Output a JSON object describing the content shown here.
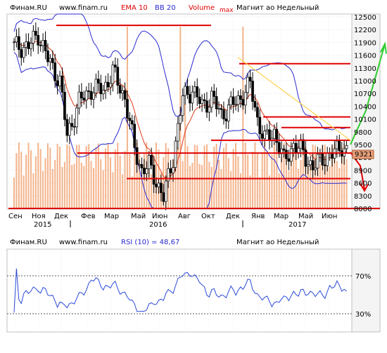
{
  "main_panel": {
    "header": {
      "source": "Финам.RU",
      "site": "www.finam.ru",
      "ema": "EMA 10",
      "bb": "BB 20",
      "volume": "Volume",
      "max_label": "max",
      "instrument": "Магнит ао Недельный"
    },
    "last_price_label": "9321",
    "price_ticks": [
      "12500",
      "12200",
      "11900",
      "11600",
      "11300",
      "11000",
      "10700",
      "10400",
      "10100",
      "9800",
      "9500",
      "9200",
      "8900",
      "8600",
      "8300",
      "8000"
    ],
    "month_ticks": [
      "Сен",
      "Ноя",
      "Дек",
      "Фев",
      "Мар",
      "Май",
      "Июн",
      "Авг",
      "Окт",
      "Дек",
      "Янв",
      "Мар",
      "Май",
      "Июн"
    ],
    "year_ticks": [
      "2015",
      "2016",
      "2017"
    ]
  },
  "rsi_panel": {
    "header": {
      "source": "Финам.RU",
      "site": "www.finam.ru",
      "indicator": "RSI (10) = 48,67",
      "instrument": "Магнит ао Недельный"
    },
    "level_ticks": [
      "70%",
      "30%"
    ]
  },
  "colors": {
    "frame": "#c0c0c0",
    "price_scale_bg": "#f4f4f4",
    "candle_up": "#ffffff",
    "candle_down": "#000000",
    "ema": "#e03a1a",
    "bollinger": "#2a2ad0",
    "volume": "#f4b48c",
    "support_resistance": "#e00000",
    "trend_line": "#ffd24a",
    "up_arrow": "#2fcc2f",
    "down_arrow": "#e00000",
    "rsi_line": "#2a4ad8"
  },
  "chart_data": [
    {
      "type": "candlestick",
      "title": "Магнит ао Недельный",
      "indicators": [
        "EMA 10",
        "BB 20",
        "Volume"
      ],
      "ylim": [
        8000,
        12500
      ],
      "y_ticks": [
        12500,
        12200,
        11900,
        11600,
        11300,
        11000,
        10700,
        10400,
        10100,
        9800,
        9500,
        9200,
        8900,
        8600,
        8300,
        8000
      ],
      "last_price": 9321,
      "grid": true,
      "horizontal_levels": [
        12300,
        11400,
        10150,
        9900,
        9600,
        9300,
        8700,
        8000
      ],
      "note": "weekly candles Sep 2015 – Jul 2017 (approximate)"
    },
    {
      "type": "line",
      "title": "RSI (10)",
      "last_value": 48.67,
      "levels": [
        70,
        30
      ]
    }
  ]
}
